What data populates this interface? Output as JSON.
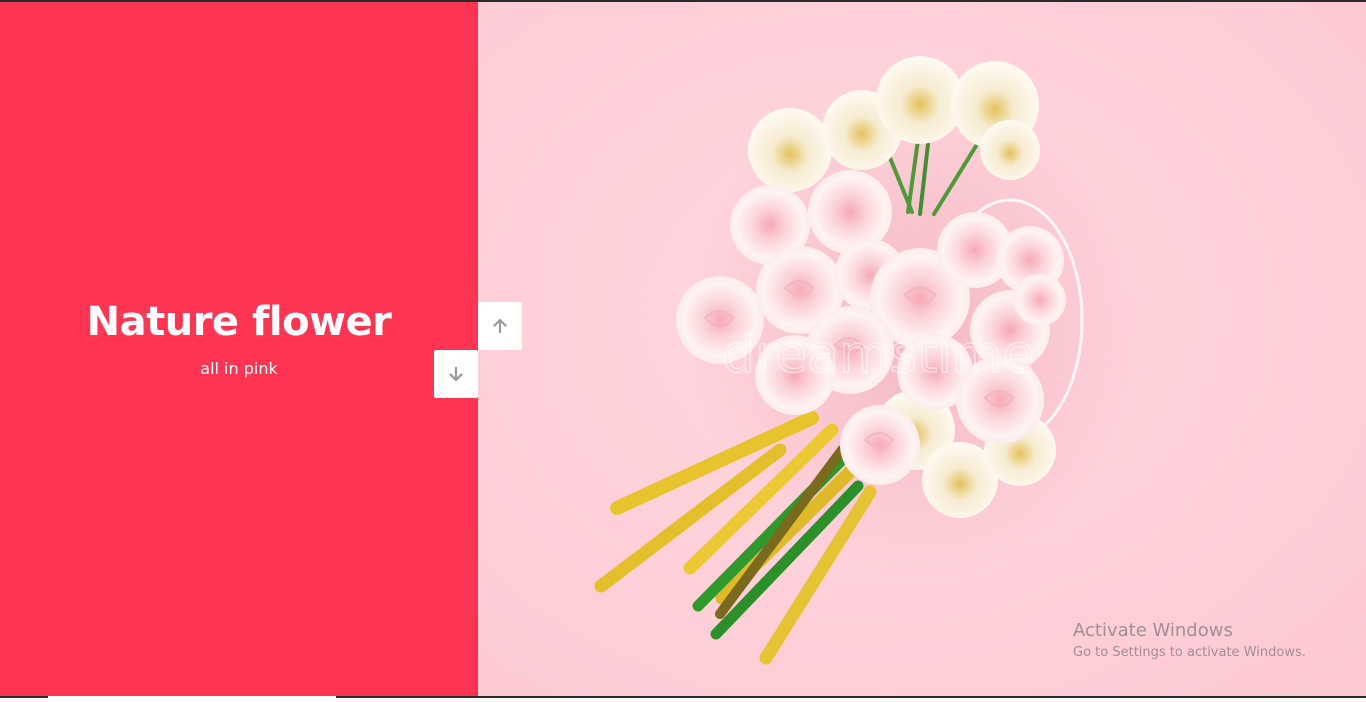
{
  "slide": {
    "title": "Nature flower",
    "subtitle": "all in pink"
  },
  "navigation": {
    "up_icon": "arrow-up-icon",
    "down_icon": "arrow-down-icon"
  },
  "image": {
    "watermark": "dreamstime"
  },
  "windows_notice": {
    "title": "Activate Windows",
    "subtitle": "Go to Settings to activate Windows."
  },
  "colors": {
    "accent": "#ff3352",
    "background_pink": "#ffd3db",
    "button_bg": "#ffffff",
    "arrow": "#9a9a9a"
  }
}
